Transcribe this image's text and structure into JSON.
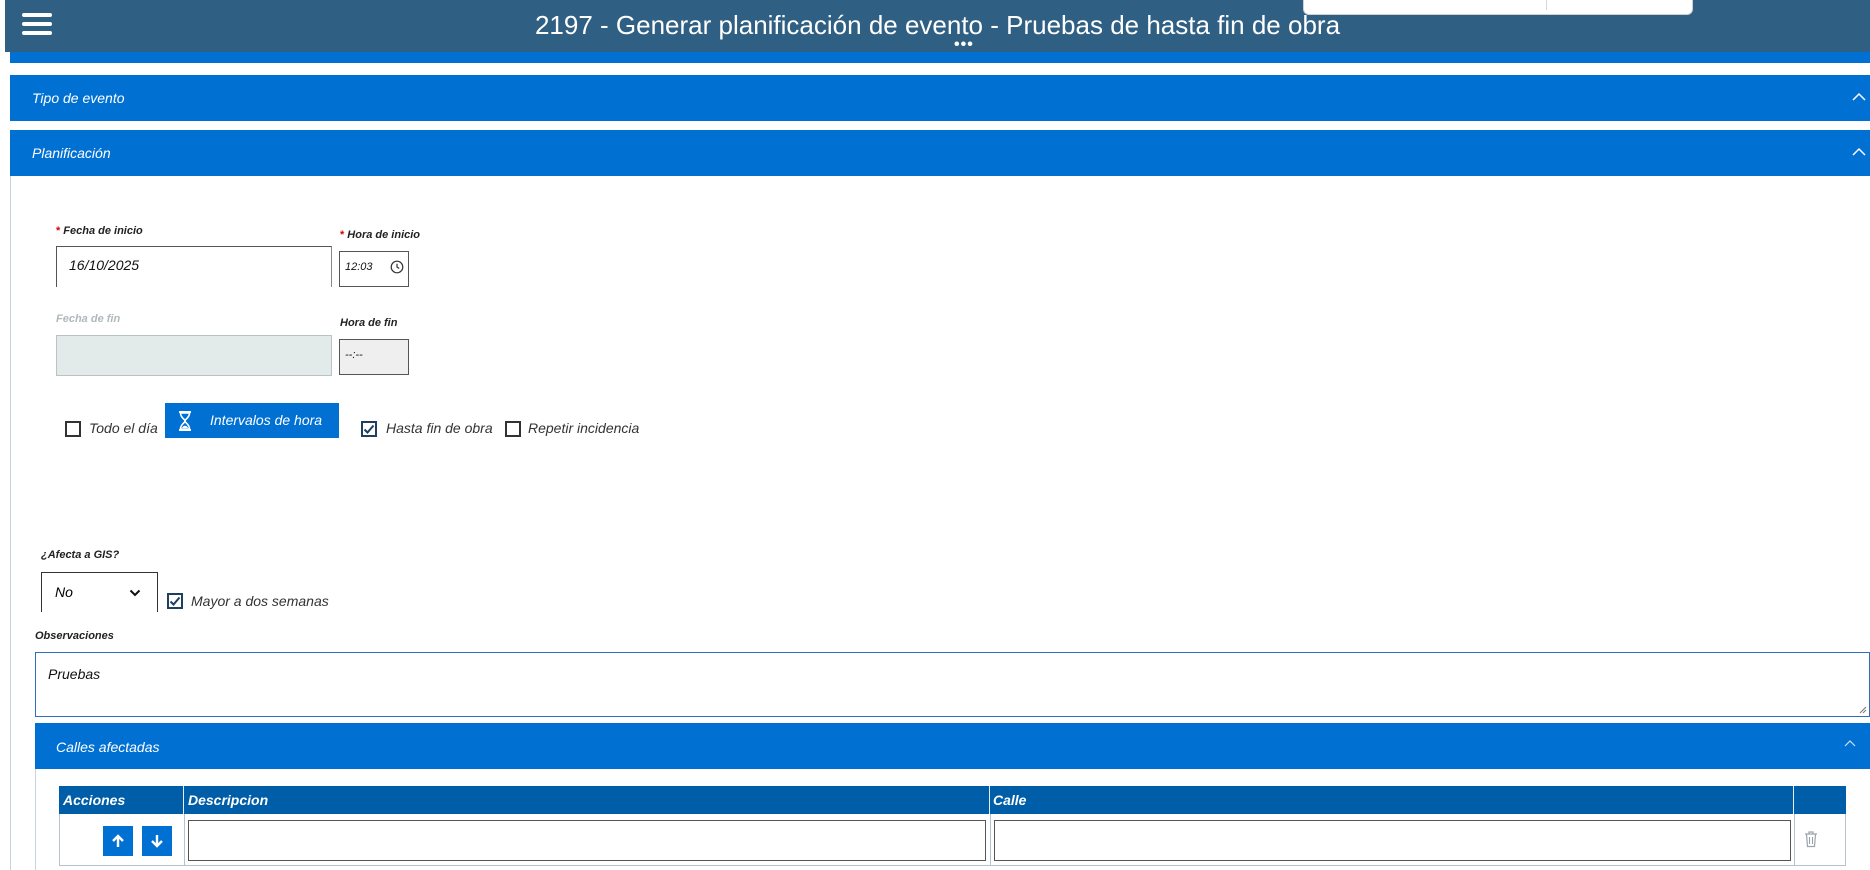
{
  "header": {
    "title": "2197 - Generar planificación de evento - Pruebas de hasta fin de obra",
    "menu_icon": "hamburger-menu-icon",
    "more_icon": "ellipsis-icon"
  },
  "sections": {
    "tipo_evento": {
      "label": "Tipo de evento"
    },
    "planificacion": {
      "label": "Planificación"
    }
  },
  "planificacion": {
    "fecha_inicio": {
      "label": "Fecha de inicio",
      "required": "*",
      "value": "16/10/2025"
    },
    "hora_inicio": {
      "label": "Hora de inicio",
      "required": "*",
      "value": "12:03"
    },
    "fecha_fin": {
      "label": "Fecha de fin",
      "value": ""
    },
    "hora_fin": {
      "label": "Hora de fin",
      "value": "--:--"
    },
    "todo_el_dia": {
      "label": "Todo el día",
      "checked": false
    },
    "intervalos_button": {
      "label": "Intervalos de hora",
      "icon": "hourglass-icon"
    },
    "hasta_fin_obra": {
      "label": "Hasta fin de obra",
      "checked": true
    },
    "repetir_incidencia": {
      "label": "Repetir incidencia",
      "checked": false
    }
  },
  "gis": {
    "label": "¿Afecta a GIS?",
    "selected": "No",
    "mayor_dos_semanas": {
      "label": "Mayor a dos semanas",
      "checked": true
    }
  },
  "observaciones": {
    "label": "Observaciones",
    "value": "Pruebas"
  },
  "calles": {
    "section_label": "Calles afectadas",
    "columns": [
      "Acciones",
      "Descripcion",
      "Calle"
    ],
    "rows": [
      {
        "descripcion": "",
        "calle": ""
      }
    ]
  },
  "colors": {
    "header_bg": "#2f5f83",
    "accent": "#0070d2",
    "table_header": "#005ea8",
    "required": "#dd0000"
  }
}
